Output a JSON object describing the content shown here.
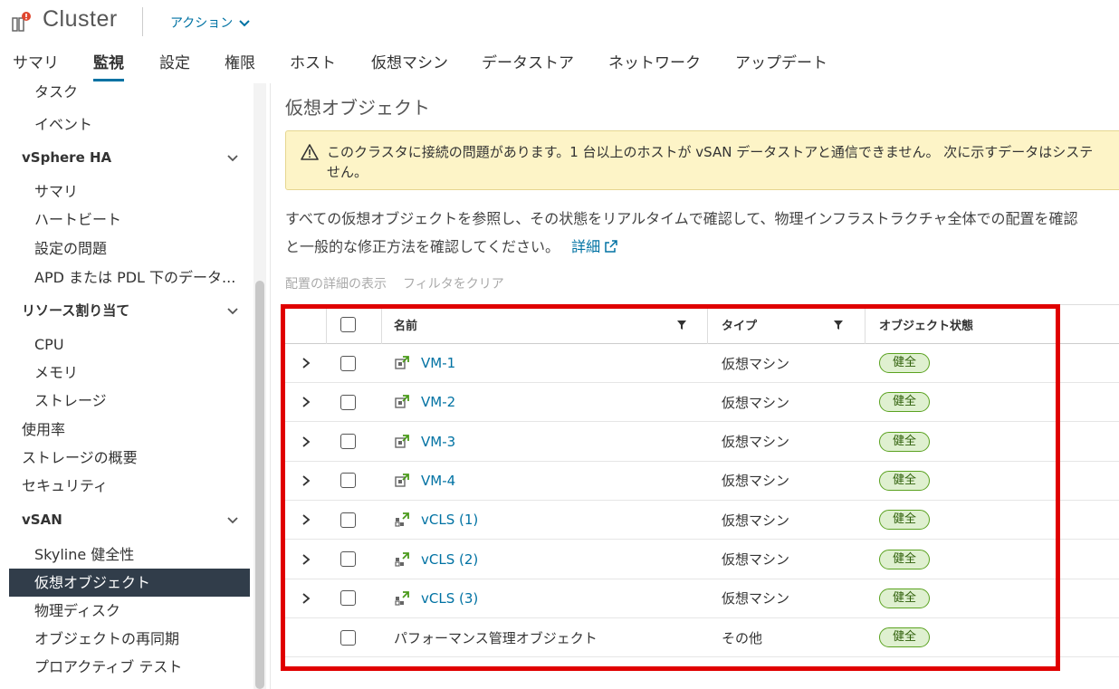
{
  "header": {
    "title": "Cluster",
    "actions_label": "アクション",
    "actions_icon": "chevron-down-icon",
    "cluster_icon": "cluster-alert-icon"
  },
  "tabs": [
    {
      "label": "サマリ",
      "active": false
    },
    {
      "label": "監視",
      "active": true
    },
    {
      "label": "設定",
      "active": false
    },
    {
      "label": "権限",
      "active": false
    },
    {
      "label": "ホスト",
      "active": false
    },
    {
      "label": "仮想マシン",
      "active": false
    },
    {
      "label": "データストア",
      "active": false
    },
    {
      "label": "ネットワーク",
      "active": false
    },
    {
      "label": "アップデート",
      "active": false
    }
  ],
  "sidebar": {
    "items": [
      {
        "label": "タスク"
      },
      {
        "label": "イベント"
      },
      {
        "label": "vSphere HA"
      },
      {
        "label": "サマリ"
      },
      {
        "label": "ハートビート"
      },
      {
        "label": "設定の問題"
      },
      {
        "label": "APD または PDL 下のデータ..."
      },
      {
        "label": "リソース割り当て"
      },
      {
        "label": "CPU"
      },
      {
        "label": "メモリ"
      },
      {
        "label": "ストレージ"
      },
      {
        "label": "使用率"
      },
      {
        "label": "ストレージの概要"
      },
      {
        "label": "セキュリティ"
      },
      {
        "label": "vSAN"
      },
      {
        "label": "Skyline 健全性"
      },
      {
        "label": "仮想オブジェクト"
      },
      {
        "label": "物理ディスク"
      },
      {
        "label": "オブジェクトの再同期"
      },
      {
        "label": "プロアクティブ テスト"
      }
    ]
  },
  "main": {
    "title": "仮想オブジェクト",
    "alert": {
      "icon": "warning-icon",
      "text": "このクラスタに接続の問題があります。1 台以上のホストが vSAN データストアと通信できません。 次に示すデータはシステ",
      "text2": "せん。"
    },
    "description": {
      "line1": "すべての仮想オブジェクトを参照し、その状態をリアルタイムで確認して、物理インフラストラクチャ全体での配置を確認",
      "line2": "と一般的な修正方法を確認してください。",
      "link": "詳細",
      "link_icon": "external-link-icon"
    },
    "toolbar": {
      "show_placement": "配置の詳細の表示",
      "clear_filter": "フィルタをクリア"
    },
    "grid": {
      "headers": {
        "name": "名前",
        "type": "タイプ",
        "state": "オブジェクト状態"
      },
      "rows": [
        {
          "name": "VM-1",
          "type": "仮想マシン",
          "state": "健全",
          "icon": "vm-icon",
          "expandable": true
        },
        {
          "name": "VM-2",
          "type": "仮想マシン",
          "state": "健全",
          "icon": "vm-icon",
          "expandable": true
        },
        {
          "name": "VM-3",
          "type": "仮想マシン",
          "state": "健全",
          "icon": "vm-icon",
          "expandable": true
        },
        {
          "name": "VM-4",
          "type": "仮想マシン",
          "state": "健全",
          "icon": "vm-icon",
          "expandable": true
        },
        {
          "name": "vCLS (1)",
          "type": "仮想マシン",
          "state": "健全",
          "icon": "vcls-vm-icon",
          "expandable": true
        },
        {
          "name": "vCLS (2)",
          "type": "仮想マシン",
          "state": "健全",
          "icon": "vcls-vm-icon",
          "expandable": true
        },
        {
          "name": "vCLS (3)",
          "type": "仮想マシン",
          "state": "健全",
          "icon": "vcls-vm-icon",
          "expandable": true
        },
        {
          "name": "パフォーマンス管理オブジェクト",
          "type": "その他",
          "state": "健全",
          "icon": "",
          "expandable": false
        }
      ]
    }
  },
  "colors": {
    "accent": "#0072a3",
    "selected_bg": "#313d4a",
    "alert_bg": "#fdf4c7",
    "healthy_green": "#5aa220",
    "highlight_red": "#e00000"
  }
}
